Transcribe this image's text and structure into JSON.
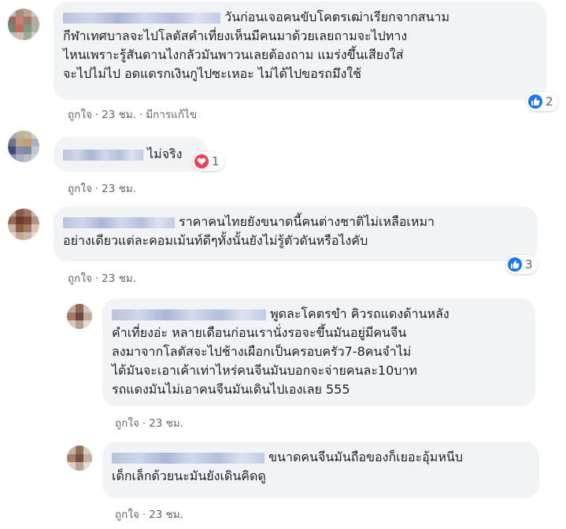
{
  "comments": [
    {
      "text": "วันก่อนเจอคนขับโคตรเฒ่าเรียกจากสนาม\nกีฬาเทศบาลจะไปโลตัสคำเที่ยงเห็นมีคนมาด้วยเลยถามจะไปทาง\nไหนเพราะรู้สันดานไงกลัวมันพาวนเลยต้องถาม แมร่งขึ้นเสียงใส่\nจะไปไม่ไป อดแดรกเงินกูไปซะเหอะ ไม่ได้ไปขอรถมึงใช้",
      "like_label": "ถูกใจ",
      "time": "23 ชม.",
      "edited_label": "มีการแก้ไข",
      "reaction_count": "2",
      "reaction_icon": "like-icon"
    },
    {
      "text": "ไม่จริง",
      "like_label": "ถูกใจ",
      "time": "23 ชม.",
      "reaction_count": "1",
      "reaction_icon": "love-icon"
    },
    {
      "text": "ราคาคนไทยยังขนาดนี้คนต่างชาติไม่เหลือเหมา\nอย่างเดียวแต่ละคอมเม้นท์ดีๆทั้งนั้นยังไม่รู้ตัวดันหรือไงคับ",
      "like_label": "ถูกใจ",
      "time": "23 ชม.",
      "reaction_count": "3",
      "reaction_icon": "like-icon"
    }
  ],
  "replies": [
    {
      "text": "พูดละโคตรขำ คิวรถแดงด้านหลัง\nคำเที่ยงอ่ะ หลายเดือนก่อนเรานั่งรอจะขึ้นมันอยู่มีคนจีน\nลงมาจากโลตัสจะไปช้างเผือกเป็นครอบครัว7-8คนจำไม่\nได้มันจะเอาเค้าเท่าไหร่คนจีนมันบอกจะจ่ายคนละ10บาท\nรถแดงมันไม่เอาคนจีนมันเดินไปเองเลย 555",
      "like_label": "ถูกใจ",
      "time": "23 ชม."
    },
    {
      "text": "ขนาดคนจีนมันถือของก็เยอะอุ้มหนีบ\nเด็กเล็กด้วยนะมันยังเดินคิดดู",
      "like_label": "ถูกใจ",
      "time": "23 ชม."
    }
  ],
  "colors": {
    "bubble": "#f2f3f5",
    "text": "#1c1e21",
    "meta": "#606770",
    "like": "#1877f2",
    "love": "#f33e58"
  }
}
